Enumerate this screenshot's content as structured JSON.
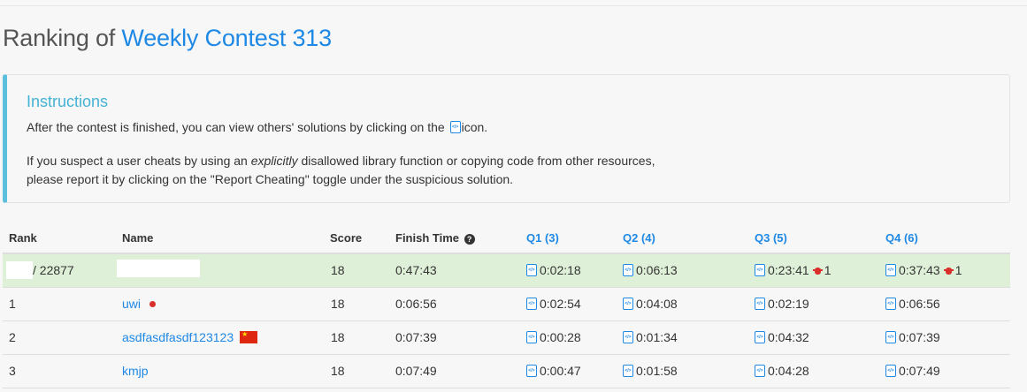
{
  "header": {
    "title_prefix": "Ranking of",
    "contest_name": "Weekly Contest 313"
  },
  "instructions": {
    "title": "Instructions",
    "p1_before": "After the contest is finished, you can view others' solutions by clicking on the",
    "p1_after": "icon.",
    "p2_line1_before": "If you suspect a user cheats by using an ",
    "p2_line1_em": "explicitly",
    "p2_line1_after": " disallowed library function or copying code from other resources,",
    "p2_line2": "please report it by clicking on the \"Report Cheating\" toggle under the suspicious solution."
  },
  "table": {
    "headers": {
      "rank": "Rank",
      "name": "Name",
      "score": "Score",
      "finish_time": "Finish Time",
      "q1": "Q1 (3)",
      "q2": "Q2 (4)",
      "q3": "Q3 (5)",
      "q4": "Q4 (6)"
    },
    "my_row": {
      "rank_total": "/ 22877",
      "score": "18",
      "finish_time": "0:47:43",
      "q1": "0:02:18",
      "q2": "0:06:13",
      "q3": "0:23:41",
      "q3_bugs": "1",
      "q4": "0:37:43",
      "q4_bugs": "1"
    },
    "rows": [
      {
        "rank": "1",
        "name": "uwi",
        "score": "18",
        "finish_time": "0:06:56",
        "q1": "0:02:54",
        "q2": "0:04:08",
        "q3": "0:02:19",
        "q4": "0:06:56"
      },
      {
        "rank": "2",
        "name": "asdfasdfasdf123123",
        "score": "18",
        "finish_time": "0:07:39",
        "q1": "0:00:28",
        "q2": "0:01:34",
        "q3": "0:04:32",
        "q4": "0:07:39"
      },
      {
        "rank": "3",
        "name": "kmjp",
        "score": "18",
        "finish_time": "0:07:49",
        "q1": "0:00:47",
        "q2": "0:01:58",
        "q3": "0:04:28",
        "q4": "0:07:49"
      }
    ]
  },
  "colors": {
    "link": "#1e88e5",
    "instructions_accent": "#5bc0de",
    "my_row_bg": "#dff0d8",
    "bug": "#d9302c"
  }
}
